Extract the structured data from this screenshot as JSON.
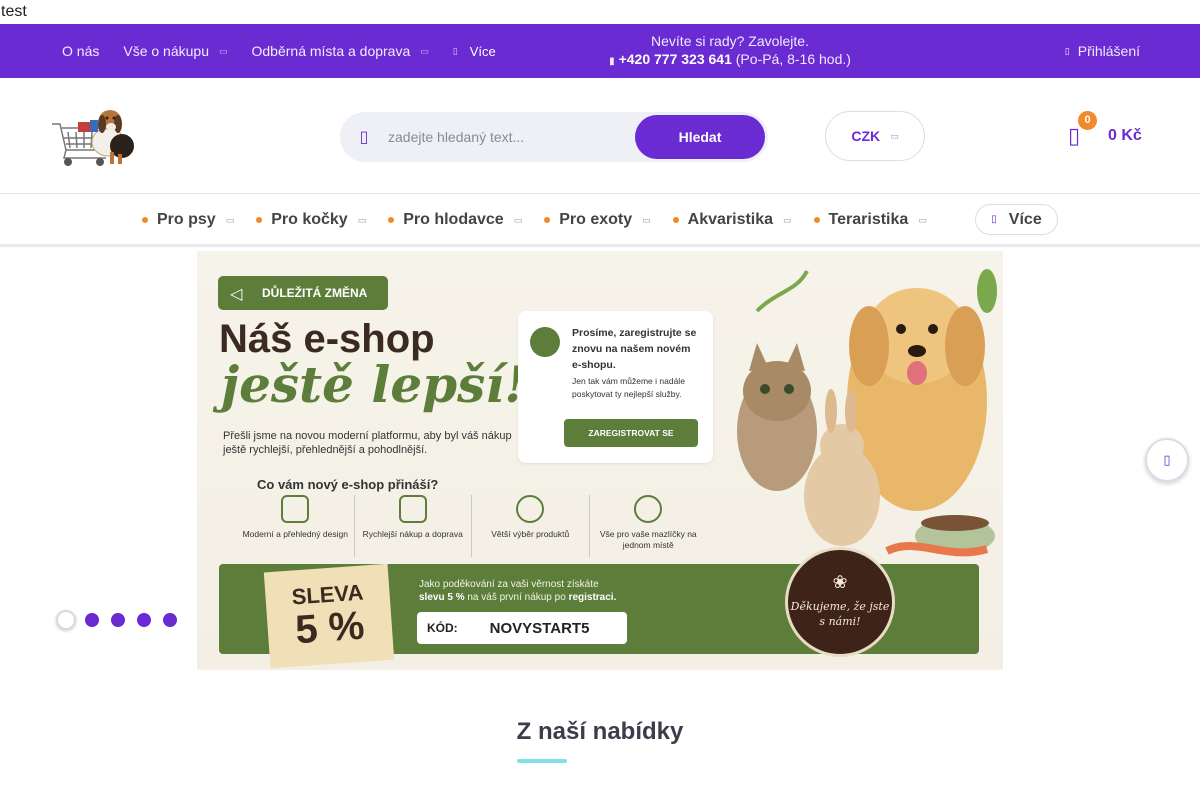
{
  "test_text": "test",
  "topbar": {
    "nav": [
      {
        "label": "O nás",
        "has_dropdown": false
      },
      {
        "label": "Vše o nákupu",
        "has_dropdown": true
      },
      {
        "label": "Odběrná místa a doprava",
        "has_dropdown": true
      }
    ],
    "more_label": "Více",
    "contact_line": "Nevíte si rady? Zavolejte.",
    "phone": "+420 777 323 641",
    "hours": "(Po-Pá, 8-16 hod.)",
    "login_label": "Přihlášení"
  },
  "header": {
    "search_placeholder": "zadejte hledaný text...",
    "search_button": "Hledat",
    "currency": "CZK",
    "cart_count": "0",
    "cart_total": "0 Kč"
  },
  "categories": [
    {
      "label": "Pro psy"
    },
    {
      "label": "Pro kočky"
    },
    {
      "label": "Pro hlodavce"
    },
    {
      "label": "Pro exoty"
    },
    {
      "label": "Akvaristika"
    },
    {
      "label": "Teraristika"
    }
  ],
  "categories_more": "Více",
  "banner": {
    "tag": "DŮLEŽITÁ ZMĚNA",
    "headline": "Náš e-shop",
    "headline_script": "ještě lepší!",
    "intro": "Přešli jsme na novou moderní platformu, aby byl váš nákup ještě rychlejší, přehlednější a pohodlnější.",
    "question": "Co vám nový e-shop přináší?",
    "features": [
      {
        "label": "Moderní a přehledný design",
        "icon": "monitor-icon"
      },
      {
        "label": "Rychlejší nákup a doprava",
        "icon": "truck-icon"
      },
      {
        "label": "Větší výběr produktů",
        "icon": "star-icon"
      },
      {
        "label": "Vše pro vaše mazlíčky na jednom místě",
        "icon": "heart-icon"
      }
    ],
    "card_title": "Prosíme, zaregistrujte se znovu na našem novém e-shopu.",
    "card_text": "Jen tak vám můžeme i nadále poskytovat ty nejlepší služby.",
    "card_button": "ZAREGISTROVAT SE",
    "coupon_line1": "SLEVA",
    "coupon_line2": "5 %",
    "thanks_text_a": "Jako poděkování za vaši věrnost získáte",
    "thanks_text_b": "slevu 5 %",
    "thanks_text_c": "na váš první nákup po",
    "thanks_text_d": "registraci.",
    "code_label": "KÓD:",
    "code_value": "NOVYSTART5",
    "seal_text": "Děkujeme, že jste s námi!"
  },
  "slider": {
    "slide_count": 5,
    "active_index": 0
  },
  "section_title": "Z naší nabídky",
  "colors": {
    "brand": "#6a2bd3",
    "accent": "#f08a2a",
    "banner_green": "#5d7d3a",
    "title_underline": "#7fe0e6"
  }
}
